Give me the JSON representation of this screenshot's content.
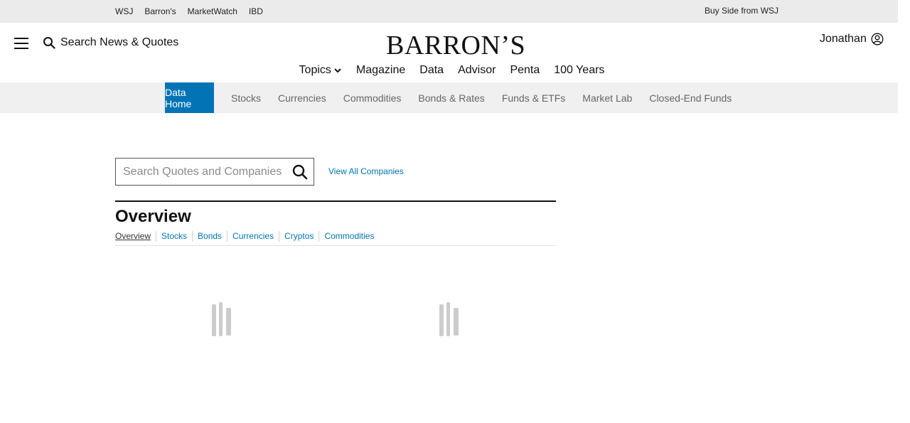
{
  "topbar": {
    "brands": [
      "WSJ",
      "Barron's",
      "MarketWatch",
      "IBD"
    ],
    "buy_side": "Buy Side from WSJ"
  },
  "header": {
    "search_label": "Search News & Quotes",
    "logo_text": "BARRON’S",
    "user_name": "Jonathan",
    "nav": [
      "Topics",
      "Magazine",
      "Data",
      "Advisor",
      "Penta",
      "100 Years"
    ]
  },
  "subnav": {
    "items": [
      "Data Home",
      "Stocks",
      "Currencies",
      "Commodities",
      "Bonds & Rates",
      "Funds & ETFs",
      "Market Lab",
      "Closed-End Funds"
    ],
    "active": "Data Home",
    "active_color": "#0274b6"
  },
  "quote_search": {
    "placeholder": "Search Quotes and Companies",
    "view_all": "View All Companies"
  },
  "overview": {
    "title": "Overview",
    "tabs": [
      "Overview",
      "Stocks",
      "Bonds",
      "Currencies",
      "Cryptos",
      "Commodities"
    ],
    "active_tab": "Overview"
  },
  "colors": {
    "link": "#0274b6",
    "topbar_bg": "#ebebeb",
    "subnav_bg": "#f0f0f0",
    "loader": "#cccccc"
  },
  "icons": {
    "menu": "hamburger-icon",
    "search": "search-icon",
    "user": "user-icon",
    "chevron": "chevron-down-icon",
    "loading": "loading-icon"
  }
}
